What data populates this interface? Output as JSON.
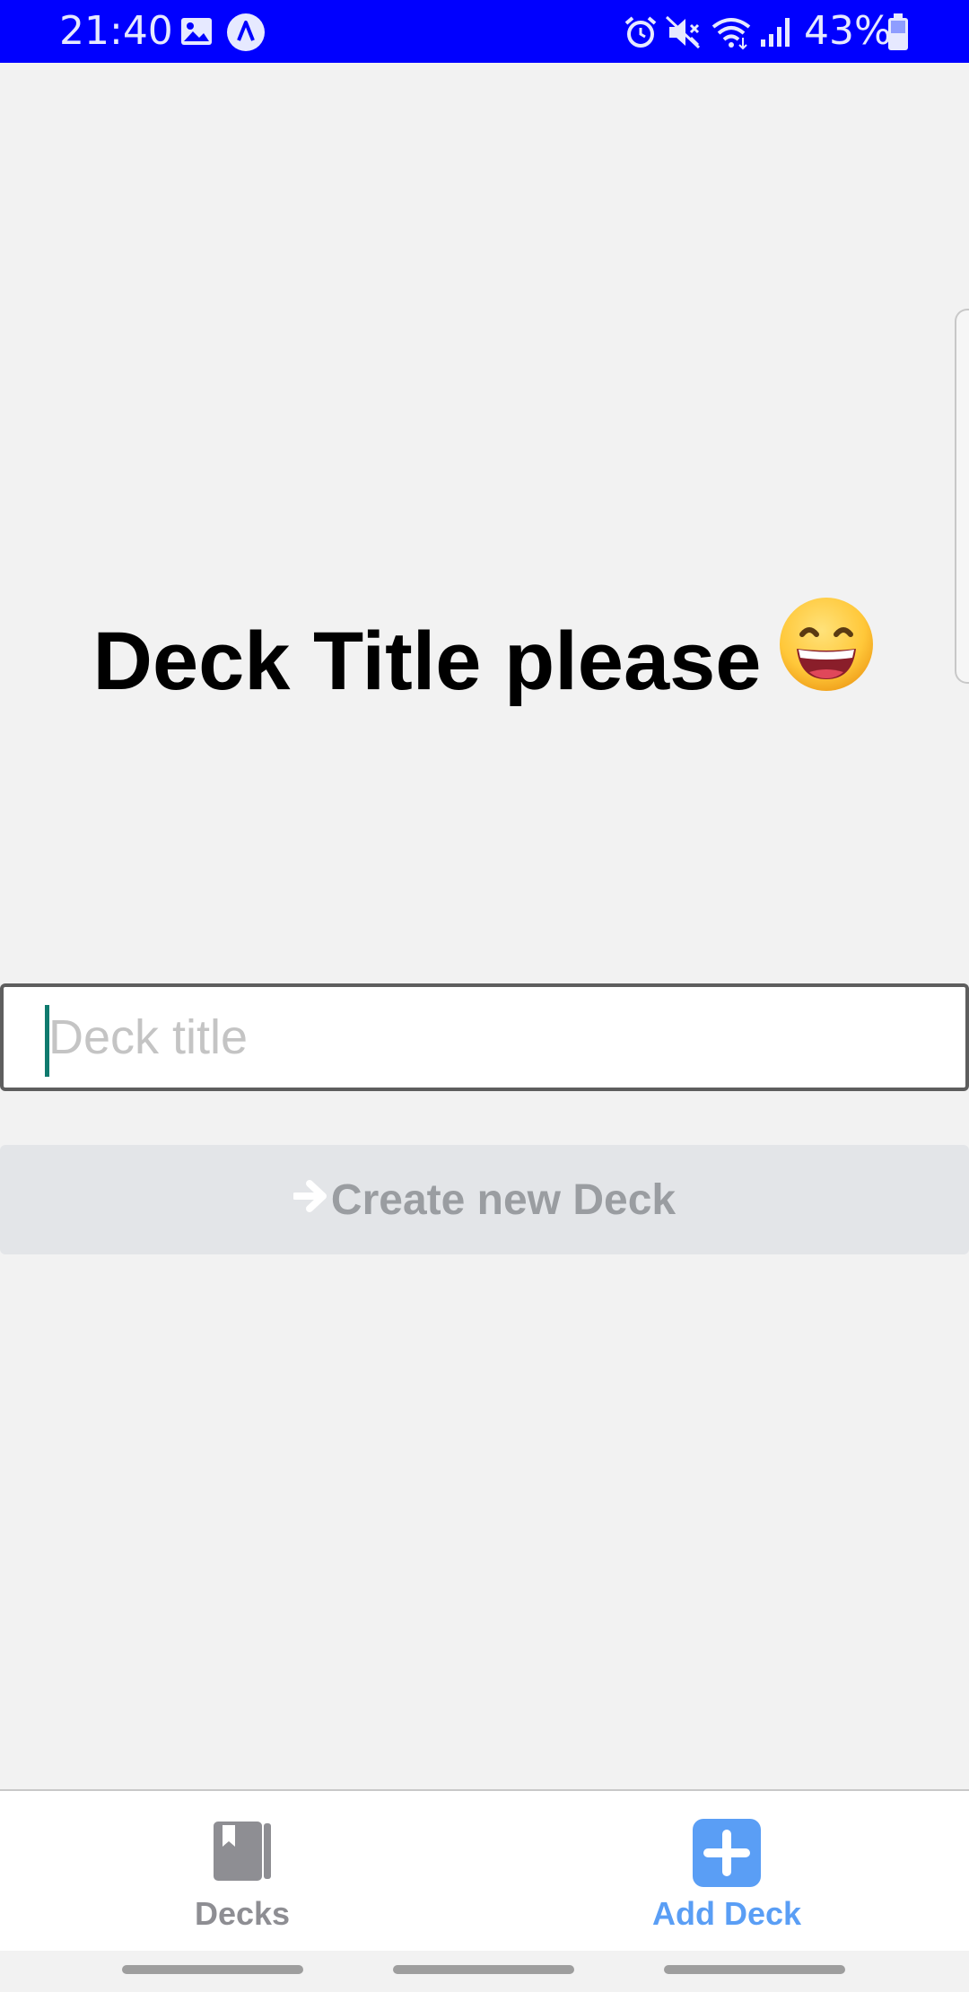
{
  "status_bar": {
    "time": "21:40",
    "battery_percent": "43%",
    "background_color": "#0000ff",
    "icons": [
      "image-icon",
      "navigation-a-icon",
      "alarm-icon",
      "mute-vibrate-icon",
      "wifi-icon",
      "signal-icon",
      "battery-icon"
    ]
  },
  "screen": {
    "heading": "Deck Title please",
    "heading_emoji": "grinning-face-emoji",
    "input": {
      "placeholder": "Deck title",
      "value": ""
    },
    "create_button": {
      "label": "Create new Deck",
      "icon": "arrow-right-icon",
      "enabled": false
    }
  },
  "tab_bar": {
    "tabs": [
      {
        "label": "Decks",
        "icon": "book-icon",
        "active": false
      },
      {
        "label": "Add Deck",
        "icon": "plus-square-icon",
        "active": true
      }
    ],
    "active_color": "#5a9ef5",
    "inactive_color": "#8e8e93"
  }
}
